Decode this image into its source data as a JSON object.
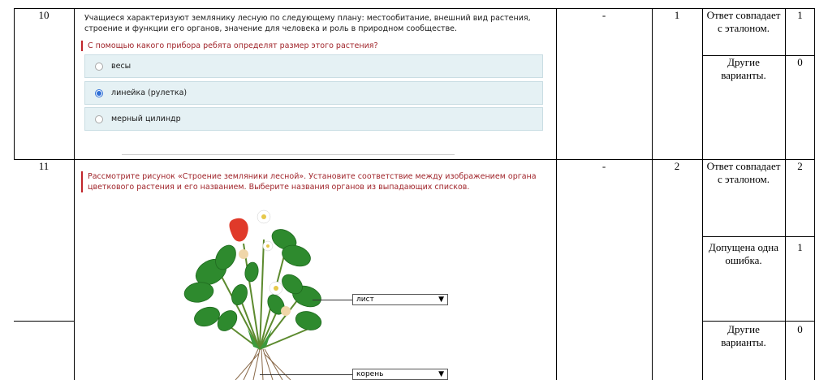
{
  "rows": [
    {
      "num": "10",
      "question_text": "Учащиеся характеризуют землянику лесную по следующему плану: местообитание, внешний вид растения, строение и функции его органов, значение для человека и роль в природном сообществе.",
      "sub_question": "С помощью какого прибора ребята определят размер этого растения?",
      "options": [
        {
          "label": "весы",
          "selected": false
        },
        {
          "label": "линейка (рулетка)",
          "selected": true
        },
        {
          "label": "мерный цилиндр",
          "selected": false
        }
      ],
      "col_dash": "-",
      "max_points": "1",
      "criteria": [
        {
          "text": "Ответ совпадает с эталоном.",
          "points": "1"
        },
        {
          "text": "Другие варианты.",
          "points": "0"
        }
      ]
    },
    {
      "num": "11",
      "question_text": "Рассмотрите рисунок «Строение земляники лесной». Установите соответствие между изображением органа цветкового растения и его названием. Выберите названия органов из выпадающих списков.",
      "dropdowns": [
        {
          "value": "лист"
        },
        {
          "value": "корень"
        }
      ],
      "col_dash": "-",
      "max_points": "2",
      "criteria": [
        {
          "text": "Ответ совпадает с эталоном.",
          "points": "2"
        },
        {
          "text": "Допущена одна ошибка.",
          "points": "1"
        },
        {
          "text": "Другие варианты.",
          "points": "0"
        }
      ]
    }
  ],
  "colors": {
    "option_bg": "#e5f1f4",
    "accent_red": "#c0242a",
    "radio_selected": "#2f6fd6",
    "leaf_green": "#2e8a2e",
    "strawberry_red": "#e03a2a"
  },
  "icons": [
    "radio-icon",
    "chevron-down-icon",
    "strawberry-plant-illustration"
  ]
}
